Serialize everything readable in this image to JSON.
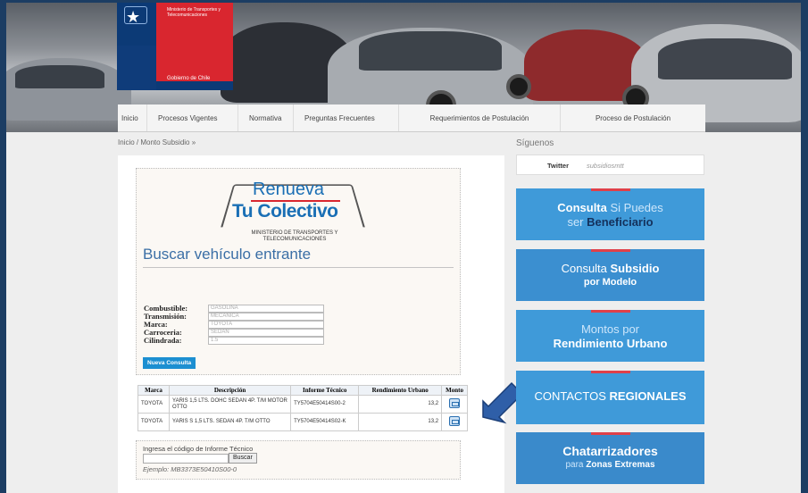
{
  "header": {
    "gov_logo_text": "Ministerio de Transportes y Telecomunicaciones",
    "gov_logo_footer": "Gobierno de Chile"
  },
  "nav": [
    "Inicio",
    "Procesos Vigentes",
    "Normativa",
    "Preguntas Frecuentes",
    "Requerimientos de Postulación",
    "Proceso de Postulación"
  ],
  "breadcrumb": "Inicio / Monto Subsidio »",
  "logo": {
    "renueva": "Renueva",
    "tu_colectivo": "Tu Colectivo",
    "ministerio": "MINISTERIO DE TRANSPORTES Y TELECOMUNICACIONES"
  },
  "search": {
    "title": "Buscar vehículo entrante",
    "fields": [
      {
        "label": "Combustible:",
        "value": "GASOLINA"
      },
      {
        "label": "Transmisión:",
        "value": "MECANICA"
      },
      {
        "label": "Marca:",
        "value": "TOYOTA"
      },
      {
        "label": "Carroceria:",
        "value": "SEDAN"
      },
      {
        "label": "Cilindrada:",
        "value": "1.5"
      }
    ],
    "new_query_button": "Nueva Consulta"
  },
  "results": {
    "headers": [
      "Marca",
      "Descripción",
      "Informe Técnico",
      "Rendimiento Urbano",
      "Monto"
    ],
    "rows": [
      {
        "marca": "TOYOTA",
        "descripcion": "YARIS 1,5 LTS. DOHC SEDAN 4P. T/M MOTOR OTTO",
        "informe": "TY5704E50414S00-2",
        "rendimiento": "13,2",
        "monto_icon": "document-icon"
      },
      {
        "marca": "TOYOTA",
        "descripcion": "YARIS S 1,5 LTS. SEDAN 4P. T/M OTTO",
        "informe": "TY5704E50414S02-K",
        "rendimiento": "13,2",
        "monto_icon": "document-icon"
      }
    ]
  },
  "codigo": {
    "label": "Ingresa el código de Informe Técnico",
    "button": "Buscar",
    "example": "Ejemplo: MB3373E50410S00-0"
  },
  "sidebar": {
    "title": "Síguenos",
    "twitter_label": "Twitter",
    "twitter_handle": "subsidiosmtt",
    "buttons": [
      {
        "line1_a": "Consulta",
        "line1_b": " Si Puedes",
        "line2_a": "ser ",
        "line2_b": "Beneficiario"
      },
      {
        "line1_a": "Consulta ",
        "line1_b": "Subsidio",
        "line2_a": "por Modelo",
        "line2_b": ""
      },
      {
        "line1_a": "Montos por",
        "line1_b": "",
        "line2_a": "Rendimiento Urbano",
        "line2_b": ""
      },
      {
        "line1_a": "CONTACTOS ",
        "line1_b": "REGIONALES",
        "line2_a": "",
        "line2_b": ""
      },
      {
        "line1_a": "Chatarrizadores",
        "line1_b": "",
        "line2_a": "para ",
        "line2_b": "Zonas Extremas"
      }
    ]
  },
  "colors": {
    "sidebar_button": "#3f9ad9",
    "accent_red": "#d9262f",
    "arrow": "#2f5fa8"
  }
}
